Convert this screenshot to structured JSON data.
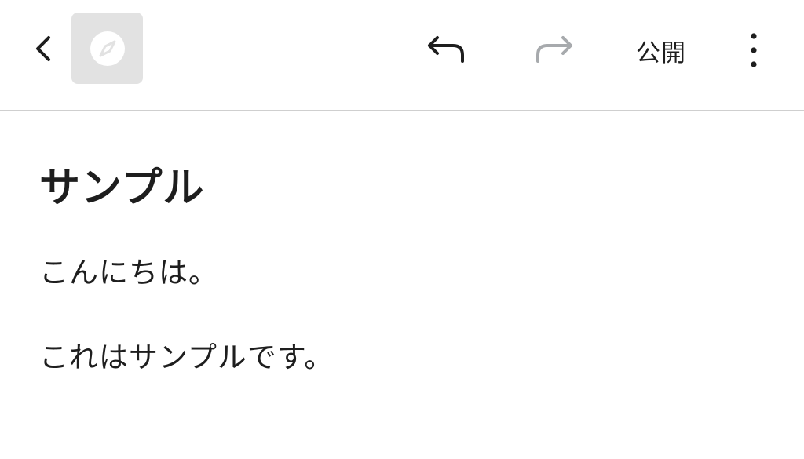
{
  "toolbar": {
    "back_icon": "chevron-left-icon",
    "site_icon": "compass-icon",
    "undo_icon": "undo-icon",
    "redo_icon": "redo-icon",
    "publish_label": "公開",
    "more_icon": "more-vertical-icon",
    "redo_color": "#a7aaad",
    "site_icon_bg": "#e2e2e2"
  },
  "post": {
    "title": "サンプル",
    "paragraphs": [
      "こんにちは。",
      "これはサンプルです。"
    ]
  }
}
